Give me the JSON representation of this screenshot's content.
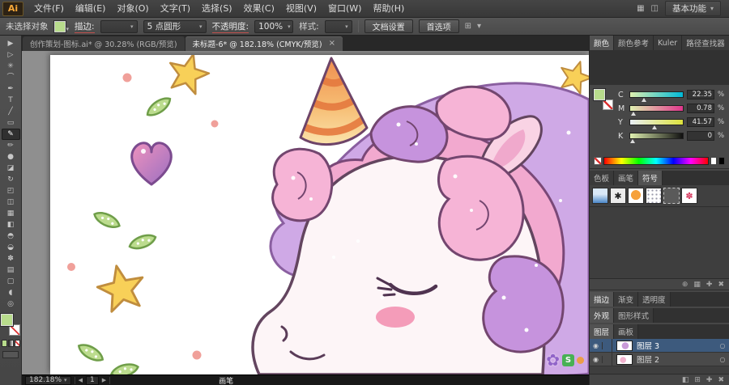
{
  "app": {
    "logo_text": "Ai",
    "workspace_label": "基本功能"
  },
  "menubar": {
    "items": [
      "文件(F)",
      "编辑(E)",
      "对象(O)",
      "文字(T)",
      "选择(S)",
      "效果(C)",
      "视图(V)",
      "窗口(W)",
      "帮助(H)"
    ]
  },
  "controlbar": {
    "no_selection_label": "未选择对象",
    "stroke_label": "描边:",
    "brush_preset_value": "5 点圆形",
    "opacity_label": "不透明度:",
    "opacity_value": "100%",
    "style_label": "样式:",
    "document_setup_label": "文档设置",
    "preferences_label": "首选项"
  },
  "doc_tabs": {
    "tab1_label": "创作策划-图标.ai* @ 30.28% (RGB/预览)",
    "tab2_label": "未标题-6* @ 182.18% (CMYK/预览)",
    "close_glyph": "×"
  },
  "toolbar_tools": [
    {
      "n": "selection-tool",
      "g": "▶"
    },
    {
      "n": "direct-selection-tool",
      "g": "▷"
    },
    {
      "n": "magic-wand-tool",
      "g": "✳"
    },
    {
      "n": "lasso-tool",
      "g": "⌒"
    },
    {
      "n": "pen-tool",
      "g": "✒"
    },
    {
      "n": "type-tool",
      "g": "T"
    },
    {
      "n": "line-segment-tool",
      "g": "╱"
    },
    {
      "n": "rectangle-tool",
      "g": "▭"
    },
    {
      "n": "paintbrush-tool",
      "g": "✎",
      "active": true
    },
    {
      "n": "pencil-tool",
      "g": "✏"
    },
    {
      "n": "blob-brush-tool",
      "g": "●"
    },
    {
      "n": "eraser-tool",
      "g": "◪"
    },
    {
      "n": "rotate-tool",
      "g": "↻"
    },
    {
      "n": "scale-tool",
      "g": "◰"
    },
    {
      "n": "width-tool",
      "g": "◫"
    },
    {
      "n": "mesh-tool",
      "g": "▦"
    },
    {
      "n": "gradient-tool",
      "g": "◧"
    },
    {
      "n": "eyedropper-tool",
      "g": "◓"
    },
    {
      "n": "blend-tool",
      "g": "◒"
    },
    {
      "n": "symbol-sprayer-tool",
      "g": "✽"
    },
    {
      "n": "graph-tool",
      "g": "▤"
    },
    {
      "n": "artboard-tool",
      "g": "▢"
    },
    {
      "n": "hand-tool",
      "g": "◖"
    },
    {
      "n": "zoom-tool",
      "g": "◎"
    }
  ],
  "color_panel": {
    "tabs": [
      {
        "label": "颜色",
        "active": true
      },
      {
        "label": "颜色参考"
      },
      {
        "label": "Kuler"
      },
      {
        "label": "路径查找器"
      }
    ],
    "channels": [
      {
        "label": "C",
        "value": "22.35",
        "unit": "%"
      },
      {
        "label": "M",
        "value": "0.78",
        "unit": "%"
      },
      {
        "label": "Y",
        "value": "41.57",
        "unit": "%"
      },
      {
        "label": "K",
        "value": "0",
        "unit": "%"
      }
    ]
  },
  "swatches_panel": {
    "tabs": [
      {
        "label": "色板"
      },
      {
        "label": "画笔"
      },
      {
        "label": "符号",
        "active": true
      }
    ]
  },
  "collapsed_groups": {
    "stroke_tabs": [
      {
        "label": "描边",
        "active": true
      },
      {
        "label": "渐变"
      },
      {
        "label": "透明度"
      }
    ],
    "appearance_tabs": [
      {
        "label": "外观",
        "active": true
      },
      {
        "label": "图形样式"
      }
    ]
  },
  "layers_panel": {
    "tabs": [
      {
        "label": "图层",
        "active": true
      },
      {
        "label": "画板"
      }
    ],
    "layers": [
      {
        "name": "图层 3",
        "selected": true
      },
      {
        "name": "图层 2"
      }
    ]
  },
  "statusbar": {
    "zoom_value": "182.18%",
    "artboard_number": "1",
    "active_tool_label": "画笔"
  },
  "watermark": {
    "badge_letter": "S"
  },
  "icons": {
    "chevron_down": "▾",
    "panel_menu": "≡",
    "arrow_left": "◀",
    "arrow_right": "▶",
    "grid": "⊞",
    "columns": "◫",
    "arrange": "▦",
    "eye": "◉",
    "target": "○",
    "clipping_mask": "◧",
    "new_sublayer": "⊞",
    "new_item": "✚",
    "delete_item": "✖",
    "library": "⊕",
    "splat": "✱",
    "flower_red": "✽",
    "flower_purple": "✿"
  },
  "theme": {
    "accent_fill_green": "#b8dc8c",
    "selection_blue": "#3d5a7d",
    "pasteboard_gray": "#8f8f8f",
    "panel_gray": "#474747"
  }
}
